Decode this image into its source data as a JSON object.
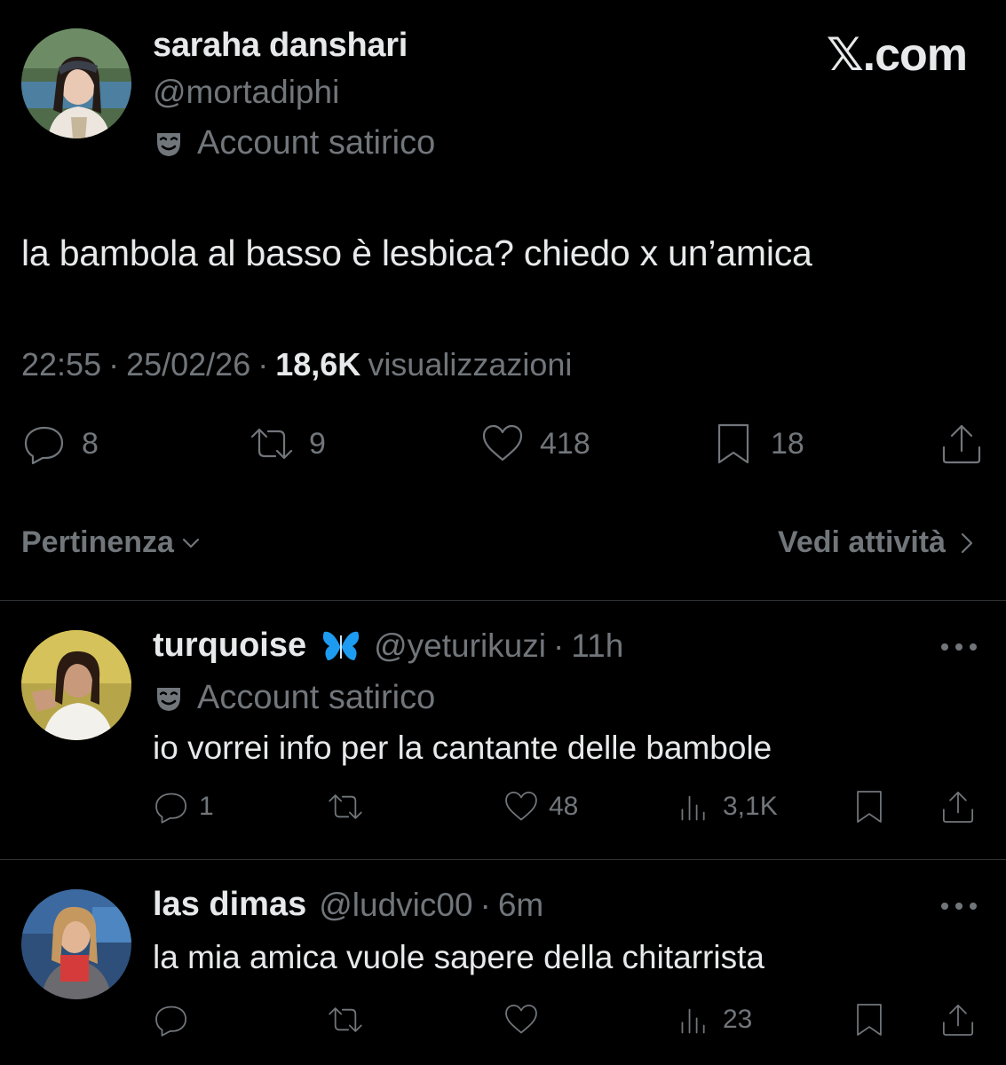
{
  "brand": "𝕏.com",
  "main_tweet": {
    "author_name": "saraha danshari",
    "author_handle": "@mortadiphi",
    "label": "Account satirico",
    "text": "la bambola al basso è lesbica? chiedo x un’amica",
    "time": "22:55",
    "date": "25/02/26",
    "views_count": "18,6K",
    "views_label": "visualizzazioni",
    "replies": "8",
    "reposts": "9",
    "likes": "418",
    "bookmarks": "18"
  },
  "sort": {
    "label": "Pertinenza",
    "activity_label": "Vedi attività"
  },
  "replies": [
    {
      "name": "turquoise",
      "badge": "🦋",
      "handle": "@yeturikuzi",
      "time": "11h",
      "label": "Account satirico",
      "text": "io vorrei info per la cantante delle bambole",
      "replies": "1",
      "reposts": "",
      "likes": "48",
      "views": "3,1K"
    },
    {
      "name": "las dimas",
      "handle": "@ludvic00",
      "time": "6m",
      "text": "la mia amica vuole sapere della chitarrista",
      "replies": "",
      "reposts": "",
      "likes": "",
      "views": "23"
    }
  ],
  "colors": {
    "background": "#000000",
    "text": "#e7e9ea",
    "muted": "#71767b",
    "divider": "#2f3336",
    "butterfly": "#1d9bf0"
  }
}
